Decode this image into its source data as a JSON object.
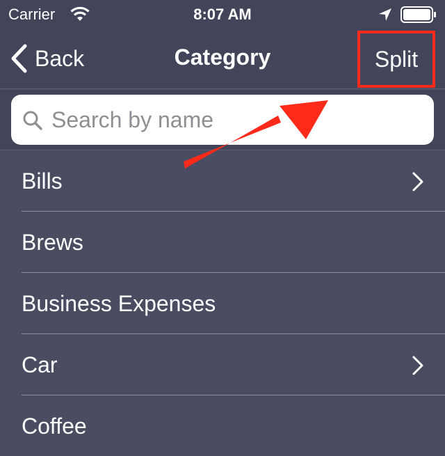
{
  "status_bar": {
    "carrier": "Carrier",
    "time": "8:07 AM"
  },
  "nav": {
    "back_label": "Back",
    "title": "Category",
    "split_label": "Split"
  },
  "search": {
    "placeholder": "Search by name",
    "value": ""
  },
  "categories": [
    {
      "label": "Bills",
      "has_children": true
    },
    {
      "label": "Brews",
      "has_children": false
    },
    {
      "label": "Business Expenses",
      "has_children": false
    },
    {
      "label": "Car",
      "has_children": true
    },
    {
      "label": "Coffee",
      "has_children": false
    }
  ],
  "colors": {
    "background": "#4a4d62",
    "bar": "#42455a",
    "highlight": "#ff2a1a",
    "text": "#ffffff"
  },
  "icons": {
    "wifi": "wifi-icon",
    "location": "location-arrow-icon",
    "battery": "battery-icon",
    "back": "chevron-left-icon",
    "search": "search-icon",
    "disclosure": "chevron-right-icon"
  }
}
